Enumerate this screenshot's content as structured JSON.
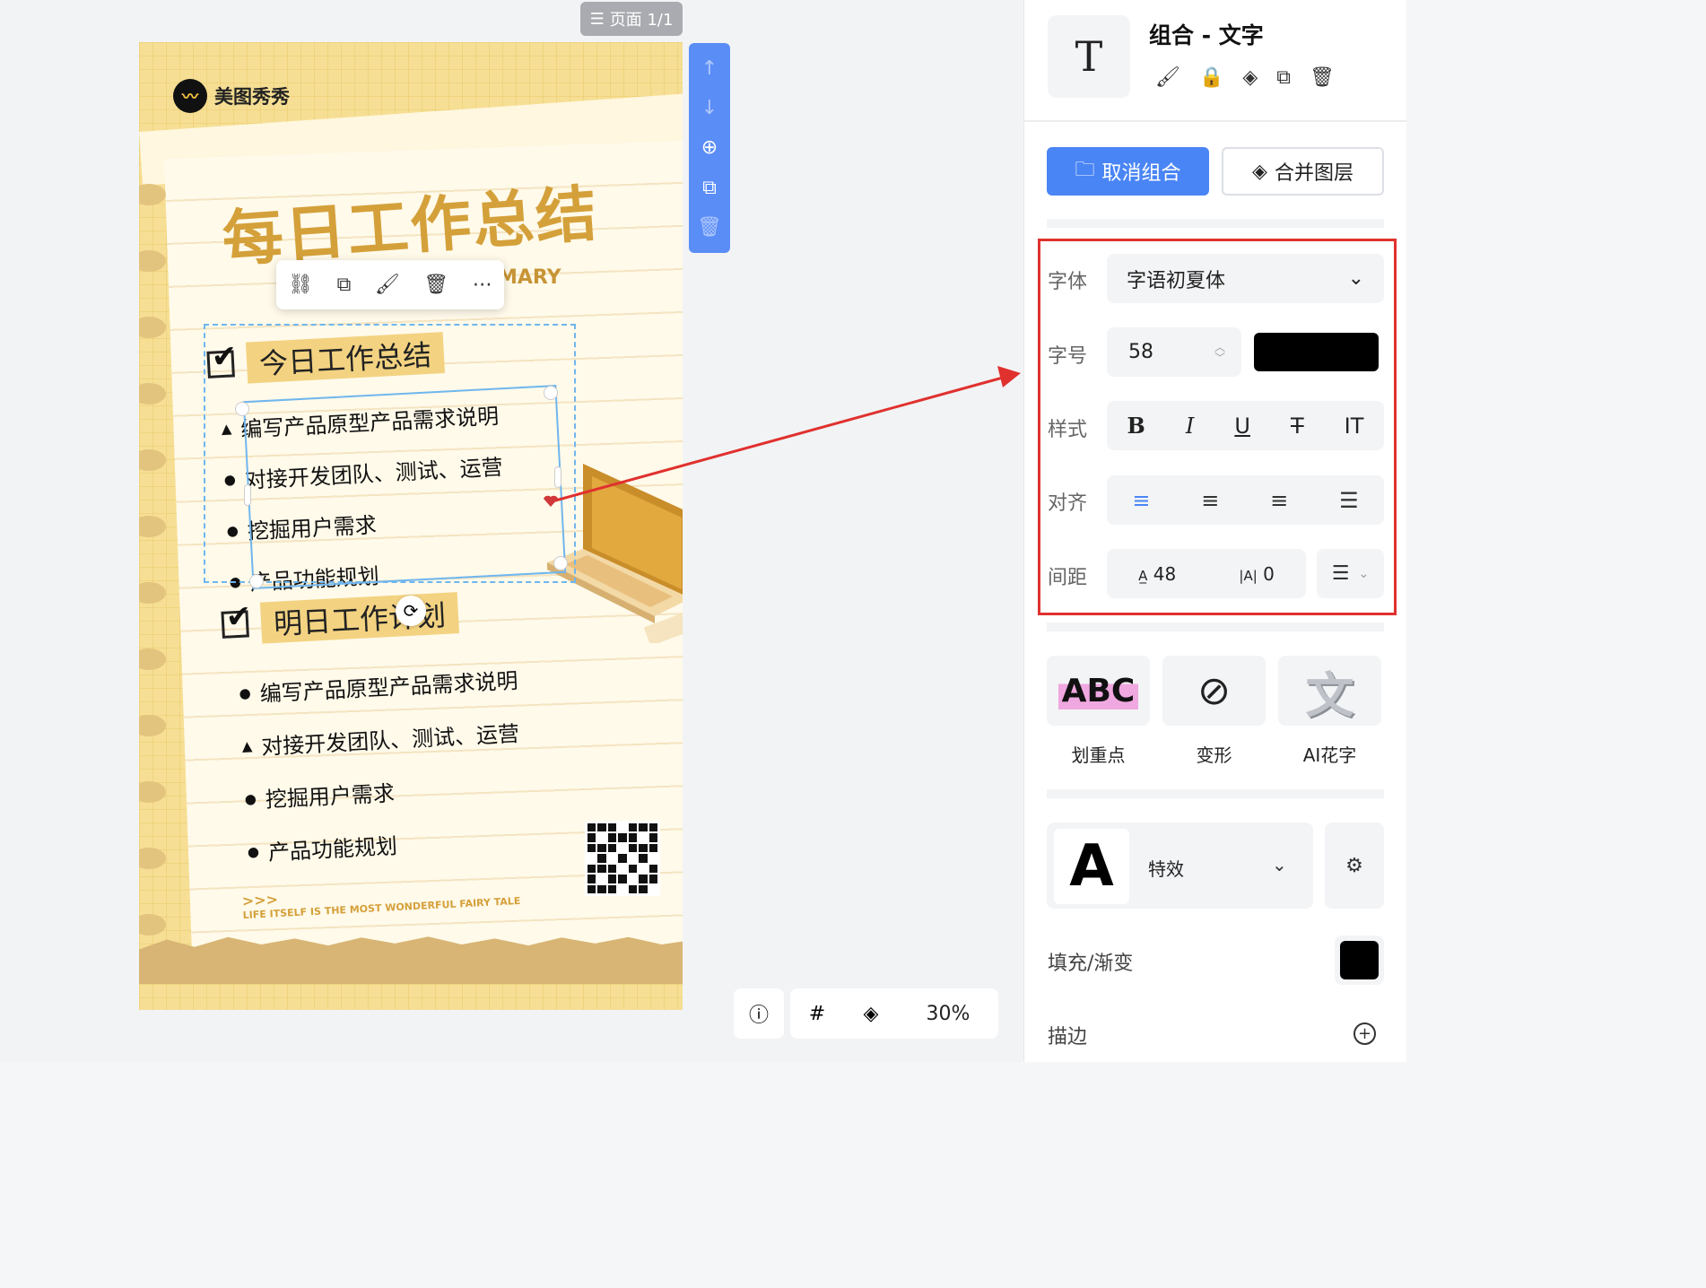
{
  "canvas": {
    "page_badge": "页面 1/1",
    "zoom": "30%"
  },
  "poster": {
    "brand": "美图秀秀",
    "title": "每日工作总结",
    "subtitle_fragment": "MARY",
    "section1": {
      "title": "今日工作总结",
      "tasks": [
        "编写产品原型产品需求说明",
        "对接开发团队、测试、运营",
        "挖掘用户需求",
        "产品功能规划"
      ]
    },
    "section2": {
      "title": "明日工作计划",
      "tasks": [
        "编写产品原型产品需求说明",
        "对接开发团队、测试、运营",
        "挖掘用户需求",
        "产品功能规划"
      ]
    },
    "slogan_arrows": ">>>",
    "slogan": "LIFE ITSELF IS THE MOST WONDERFUL FAIRY TALE"
  },
  "panel": {
    "selection_name": "组合 - 文字",
    "ungroup_label": "取消组合",
    "merge_label": "合并图层",
    "font_label": "字体",
    "font_value": "字语初夏体",
    "size_label": "字号",
    "size_value": "58",
    "text_color": "#000000",
    "style_label": "样式",
    "align_label": "对齐",
    "spacing_label": "间距",
    "letter_spacing": "48",
    "line_spacing": "0",
    "effects": [
      {
        "label": "划重点",
        "preview": "ABC"
      },
      {
        "label": "变形",
        "preview": "⊘"
      },
      {
        "label": "AI花字",
        "preview": "文"
      }
    ],
    "fx_preview": "A",
    "fx_label": "特效",
    "fill_label": "填充/渐变",
    "stroke_label": "描边"
  },
  "colors": {
    "accent": "#4a85f5",
    "highlight_box": "#e0312e",
    "poster_gold": "#d4a03a"
  }
}
